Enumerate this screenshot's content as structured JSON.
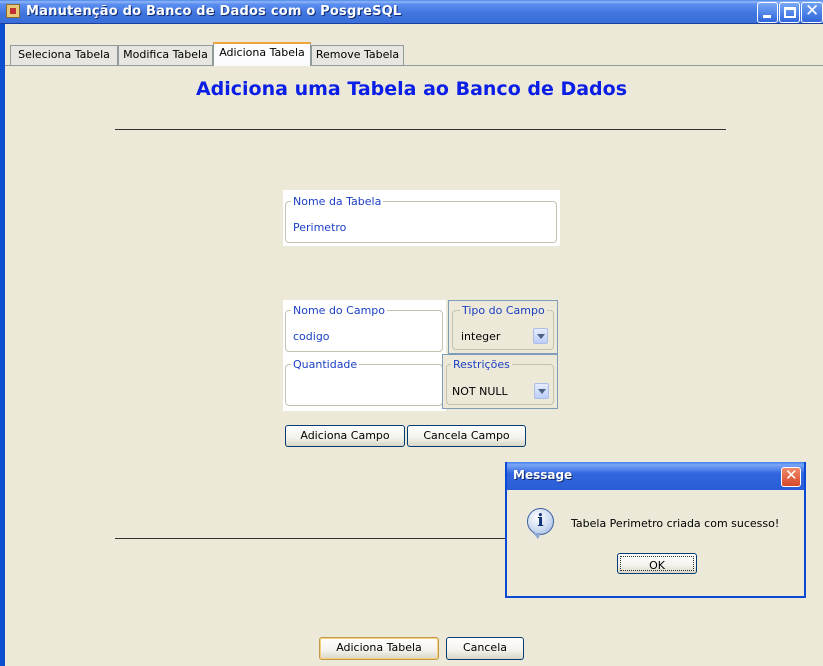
{
  "window": {
    "title": "Manutenção do Banco de Dados com o PosgreSQL"
  },
  "tabs": [
    {
      "label": "Seleciona Tabela",
      "selected": false
    },
    {
      "label": "Modifica Tabela",
      "selected": false
    },
    {
      "label": "Adiciona Tabela",
      "selected": true
    },
    {
      "label": "Remove Tabela",
      "selected": false
    }
  ],
  "page": {
    "title": "Adiciona uma Tabela ao Banco de Dados"
  },
  "form": {
    "nome_tabela": {
      "label": "Nome da Tabela",
      "value": "Perimetro"
    },
    "nome_campo": {
      "label": "Nome do Campo",
      "value": "codigo"
    },
    "quantidade": {
      "label": "Quantidade",
      "value": ""
    },
    "tipo_campo": {
      "label": "Tipo do Campo",
      "selected": "integer"
    },
    "restricoes": {
      "label": "Restrições",
      "selected": "NOT NULL"
    },
    "adiciona_campo_label": "Adiciona Campo",
    "cancela_campo_label": "Cancela Campo"
  },
  "footer": {
    "adiciona_tabela_label": "Adiciona Tabela",
    "cancela_label": "Cancela"
  },
  "dialog": {
    "title": "Message",
    "icon": "info-icon",
    "message": "Tabela Perimetro criada com sucesso!",
    "ok_label": "OK"
  },
  "colors": {
    "titlebar": "#3a6fdb",
    "heading": "#0a1ee6",
    "field_text": "#1b3fc5",
    "background": "#ece9d8"
  }
}
